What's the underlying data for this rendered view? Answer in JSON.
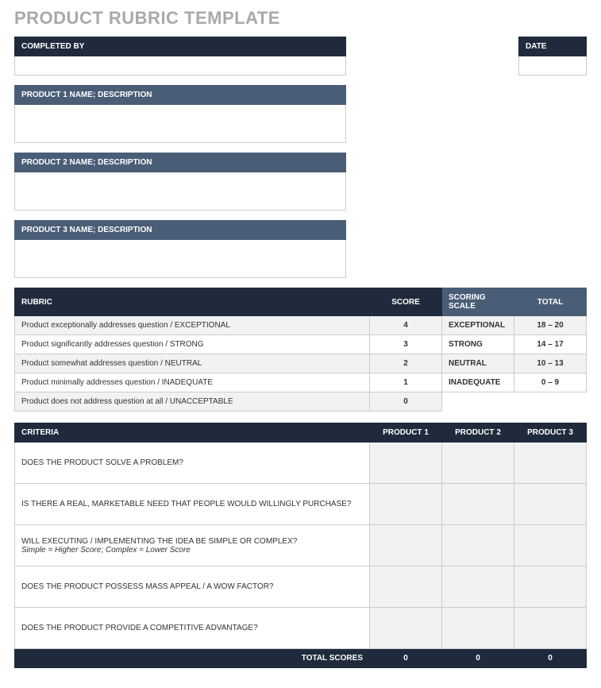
{
  "title": "PRODUCT RUBRIC TEMPLATE",
  "fields": {
    "completed_by_label": "COMPLETED BY",
    "completed_by_value": "",
    "date_label": "DATE",
    "date_value": "",
    "products": [
      {
        "label": "PRODUCT 1 NAME; DESCRIPTION",
        "value": ""
      },
      {
        "label": "PRODUCT 2 NAME; DESCRIPTION",
        "value": ""
      },
      {
        "label": "PRODUCT 3 NAME; DESCRIPTION",
        "value": ""
      }
    ]
  },
  "rubric": {
    "headers": {
      "rubric": "RUBRIC",
      "score": "SCORE",
      "scale": "SCORING SCALE",
      "total": "TOTAL"
    },
    "rows": [
      {
        "desc": "Product exceptionally addresses question / EXCEPTIONAL",
        "score": "4",
        "scale": "EXCEPTIONAL",
        "total": "18 – 20"
      },
      {
        "desc": "Product significantly addresses question / STRONG",
        "score": "3",
        "scale": "STRONG",
        "total": "14 – 17"
      },
      {
        "desc": "Product somewhat addresses question / NEUTRAL",
        "score": "2",
        "scale": "NEUTRAL",
        "total": "10 – 13"
      },
      {
        "desc": "Product minimally addresses question / INADEQUATE",
        "score": "1",
        "scale": "INADEQUATE",
        "total": "0 – 9"
      },
      {
        "desc": "Product does not address question at all / UNACCEPTABLE",
        "score": "0",
        "scale": "",
        "total": ""
      }
    ]
  },
  "criteria": {
    "headers": {
      "criteria": "CRITERIA",
      "p1": "PRODUCT 1",
      "p2": "PRODUCT 2",
      "p3": "PRODUCT 3"
    },
    "rows": [
      {
        "text": "DOES THE PRODUCT SOLVE A PROBLEM?",
        "note": "",
        "p1": "",
        "p2": "",
        "p3": ""
      },
      {
        "text": "IS THERE A REAL, MARKETABLE NEED THAT PEOPLE WOULD WILLINGLY PURCHASE?",
        "note": "",
        "p1": "",
        "p2": "",
        "p3": ""
      },
      {
        "text": "WILL EXECUTING / IMPLEMENTING THE IDEA BE SIMPLE OR COMPLEX?",
        "note": "Simple = Higher Score; Complex = Lower Score",
        "p1": "",
        "p2": "",
        "p3": ""
      },
      {
        "text": "DOES THE PRODUCT POSSESS MASS APPEAL / A WOW FACTOR?",
        "note": "",
        "p1": "",
        "p2": "",
        "p3": ""
      },
      {
        "text": "DOES THE PRODUCT PROVIDE A COMPETITIVE ADVANTAGE?",
        "note": "",
        "p1": "",
        "p2": "",
        "p3": ""
      }
    ],
    "totals": {
      "label": "TOTAL SCORES",
      "p1": "0",
      "p2": "0",
      "p3": "0"
    }
  }
}
